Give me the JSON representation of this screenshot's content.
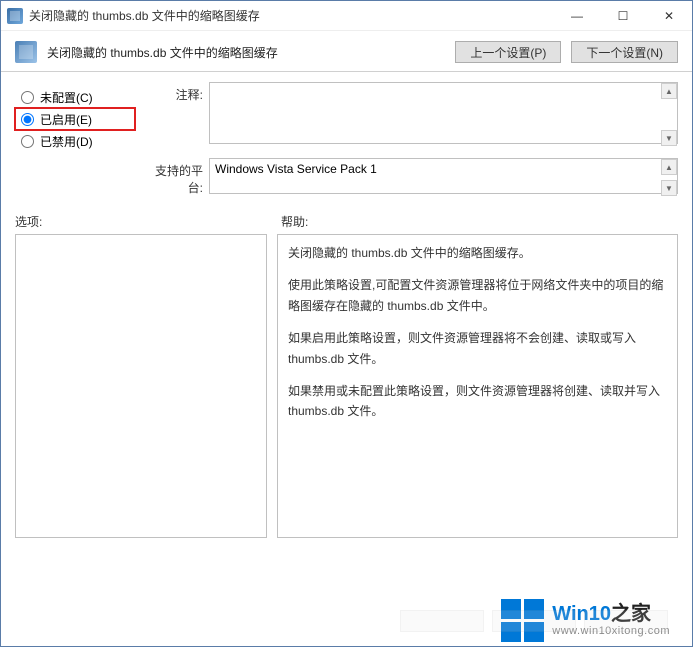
{
  "window": {
    "title": "关闭隐藏的 thumbs.db 文件中的缩略图缓存"
  },
  "header": {
    "title": "关闭隐藏的 thumbs.db 文件中的缩略图缓存",
    "prev_btn": "上一个设置(P)",
    "next_btn": "下一个设置(N)"
  },
  "radios": {
    "not_configured": "未配置(C)",
    "enabled": "已启用(E)",
    "disabled": "已禁用(D)",
    "selected": "enabled"
  },
  "labels": {
    "comment": "注释:",
    "platform": "支持的平台:",
    "options": "选项:",
    "help": "帮助:"
  },
  "fields": {
    "comment": "",
    "platform": "Windows Vista Service Pack 1"
  },
  "help_paragraphs": [
    "关闭隐藏的 thumbs.db 文件中的缩略图缓存。",
    "使用此策略设置,可配置文件资源管理器将位于网络文件夹中的项目的缩略图缓存在隐藏的 thumbs.db 文件中。",
    "如果启用此策略设置，则文件资源管理器将不会创建、读取或写入 thumbs.db 文件。",
    "如果禁用或未配置此策略设置，则文件资源管理器将创建、读取并写入 thumbs.db 文件。"
  ],
  "watermark": {
    "big_prefix": "Win10",
    "big_suffix": "之家",
    "small": "www.win10xitong.com"
  },
  "winbuttons": {
    "min": "—",
    "max": "☐",
    "close": "✕"
  }
}
